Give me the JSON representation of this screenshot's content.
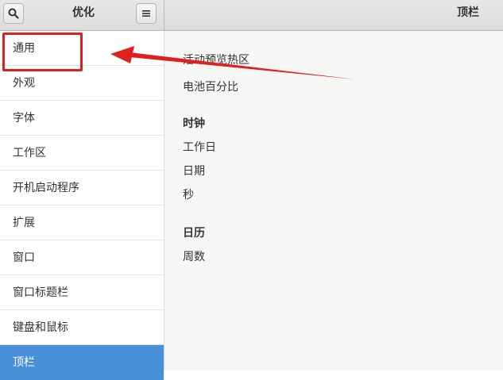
{
  "header": {
    "app_title": "优化",
    "page_title": "顶栏",
    "search_icon": "search-icon",
    "menu_icon": "hamburger-menu-icon"
  },
  "sidebar": {
    "items": [
      {
        "label": "通用"
      },
      {
        "label": "外观"
      },
      {
        "label": "字体"
      },
      {
        "label": "工作区"
      },
      {
        "label": "开机启动程序"
      },
      {
        "label": "扩展"
      },
      {
        "label": "窗口"
      },
      {
        "label": "窗口标题栏"
      },
      {
        "label": "键盘和鼠标"
      },
      {
        "label": "顶栏",
        "selected": true
      }
    ]
  },
  "content": {
    "hot_corner": "活动预览热区",
    "battery_percentage": "电池百分比",
    "clock_heading": "时钟",
    "weekday": "工作日",
    "date": "日期",
    "seconds": "秒",
    "calendar_heading": "日历",
    "week_numbers": "周数"
  },
  "colors": {
    "accent": "#4a90d9",
    "annotation": "#e0201c"
  }
}
